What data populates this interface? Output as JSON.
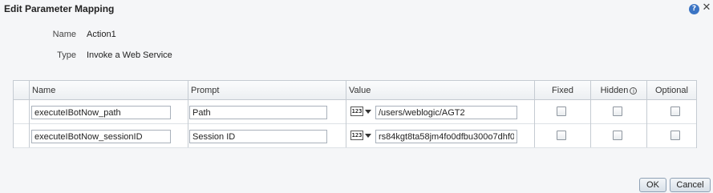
{
  "dialog": {
    "title": "Edit Parameter Mapping",
    "help_icon": "help-icon",
    "close_icon": "close-icon"
  },
  "action": {
    "name_label": "Name",
    "name_value": "Action1",
    "type_label": "Type",
    "type_value": "Invoke a Web Service"
  },
  "table": {
    "columns": [
      "Name",
      "Prompt",
      "Value",
      "Fixed",
      "Hidden",
      "Optional"
    ],
    "rows": [
      {
        "name": "executeIBotNow_path",
        "prompt": "Path",
        "value_type_icon": "number-type-icon",
        "value_type_label": "123",
        "value": "/users/weblogic/AGT2",
        "fixed": false,
        "hidden": false,
        "optional": false
      },
      {
        "name": "executeIBotNow_sessionID",
        "prompt": "Session ID",
        "value_type_icon": "number-type-icon",
        "value_type_label": "123",
        "value": "rs84kgt8ta58jm4fo0dfbu300o7dhf0",
        "fixed": false,
        "hidden": false,
        "optional": false
      }
    ]
  },
  "buttons": {
    "ok_label": "OK",
    "cancel_label": "Cancel"
  }
}
